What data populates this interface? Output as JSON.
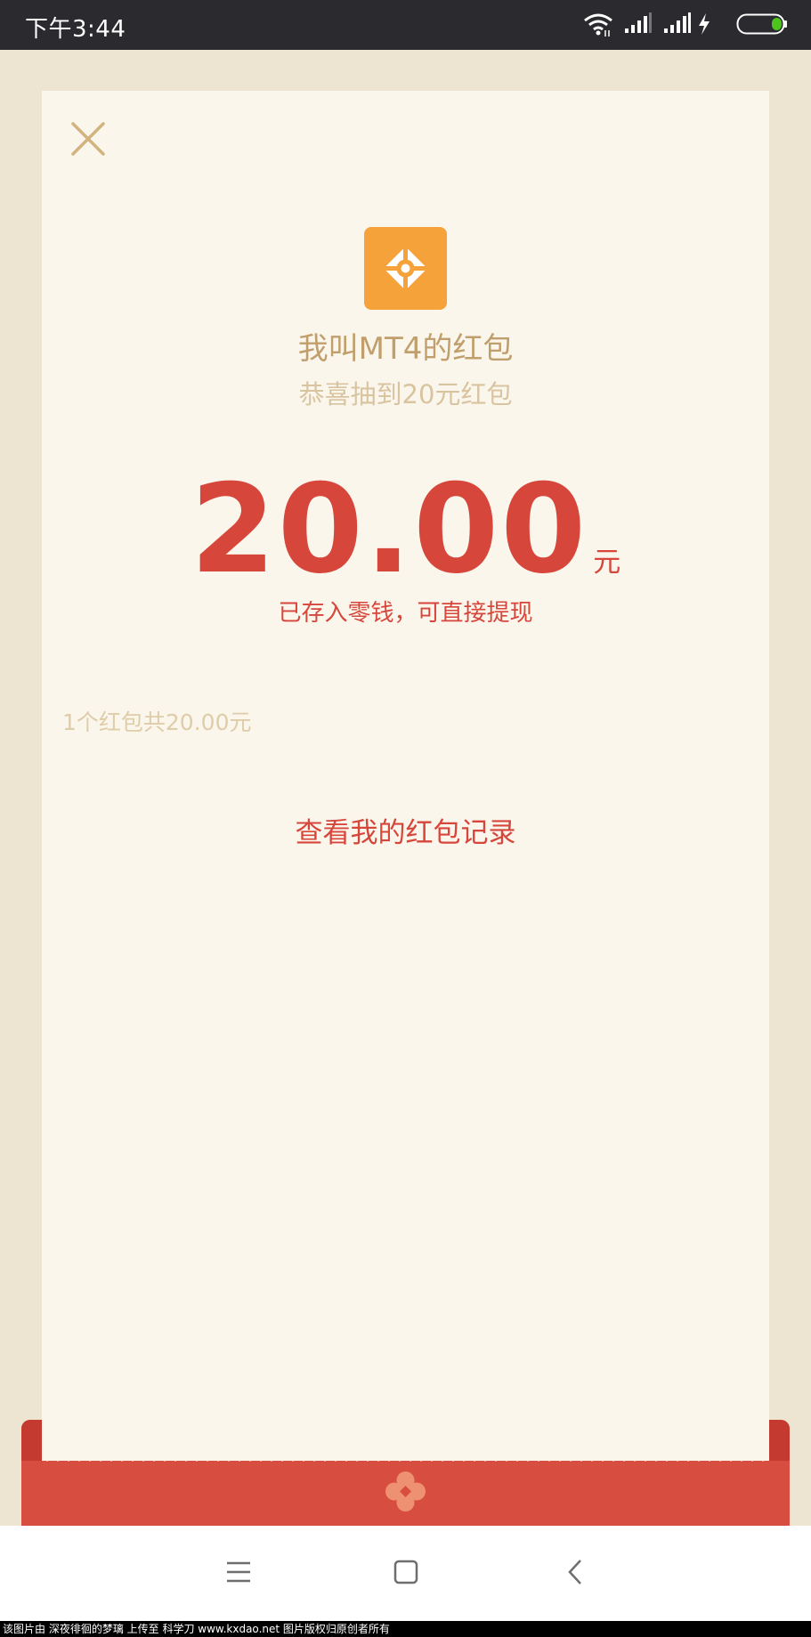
{
  "status_bar": {
    "time": "下午3:44",
    "icons": [
      "wifi-icon",
      "signal-icon",
      "signal-icon",
      "charging-icon",
      "battery-icon"
    ],
    "battery_color": "#4cc51d"
  },
  "red_packet": {
    "close_icon": "close-icon",
    "logo_icon": "app-logo-icon",
    "sender_title": "我叫MT4的红包",
    "greeting": "恭喜抽到20元红包",
    "amount": "20.00",
    "amount_unit": "元",
    "deposit_note": "已存入零钱，可直接提现",
    "summary": "1个红包共20.00元",
    "history_link": "查看我的红包记录"
  },
  "colors": {
    "accent_red": "#d6463b",
    "gold_text": "#c19f6d",
    "logo_orange": "#f6a23b",
    "card_background": "#fbf6ec",
    "page_background": "#ede4d2"
  },
  "nav_bar": {
    "icons": [
      "menu-icon",
      "home-icon",
      "back-icon"
    ]
  },
  "watermark": "该图片由 深夜徘徊的梦璃 上传至 科学刀 www.kxdao.net 图片版权归原创者所有"
}
